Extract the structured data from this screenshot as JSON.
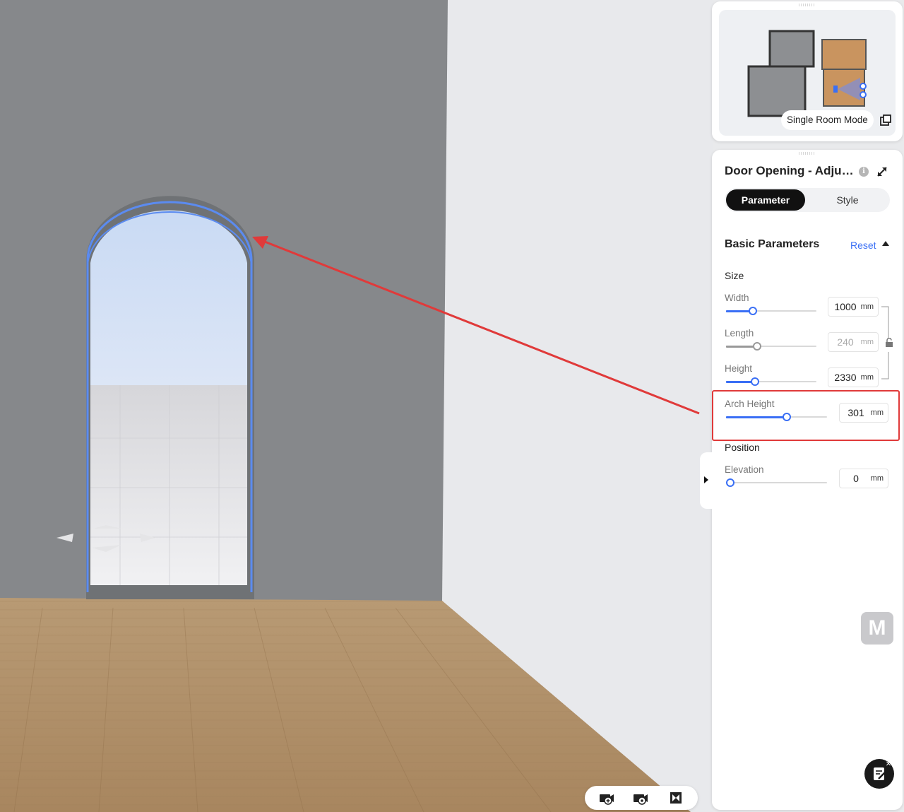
{
  "minimap": {
    "mode_label": "Single Room Mode",
    "mode_icon": "popout-icon"
  },
  "panel": {
    "title": "Door Opening - Adju…",
    "info_icon": "i",
    "tabs": [
      {
        "label": "Parameter",
        "active": true
      },
      {
        "label": "Style",
        "active": false
      }
    ],
    "section": {
      "title": "Basic Parameters",
      "reset_label": "Reset"
    },
    "size_group": {
      "label": "Size",
      "params": [
        {
          "label": "Width",
          "value": "1000",
          "unit": "mm",
          "level": 0.3,
          "disabled": false
        },
        {
          "label": "Length",
          "value": "240",
          "unit": "mm",
          "level": 0.34,
          "disabled": true
        },
        {
          "label": "Height",
          "value": "2330",
          "unit": "mm",
          "level": 0.32,
          "disabled": false
        }
      ],
      "arch": {
        "label": "Arch Height",
        "value": "301",
        "unit": "mm",
        "level": 0.6
      }
    },
    "position_group": {
      "label": "Position",
      "params": [
        {
          "label": "Elevation",
          "value": "0",
          "unit": "mm",
          "level": 0.0
        }
      ]
    }
  },
  "logo_letter": "M",
  "colors": {
    "accent": "#3a6ff5",
    "highlight": "#e03a3a",
    "wall": "#86888b",
    "floor": "#b8956d"
  }
}
